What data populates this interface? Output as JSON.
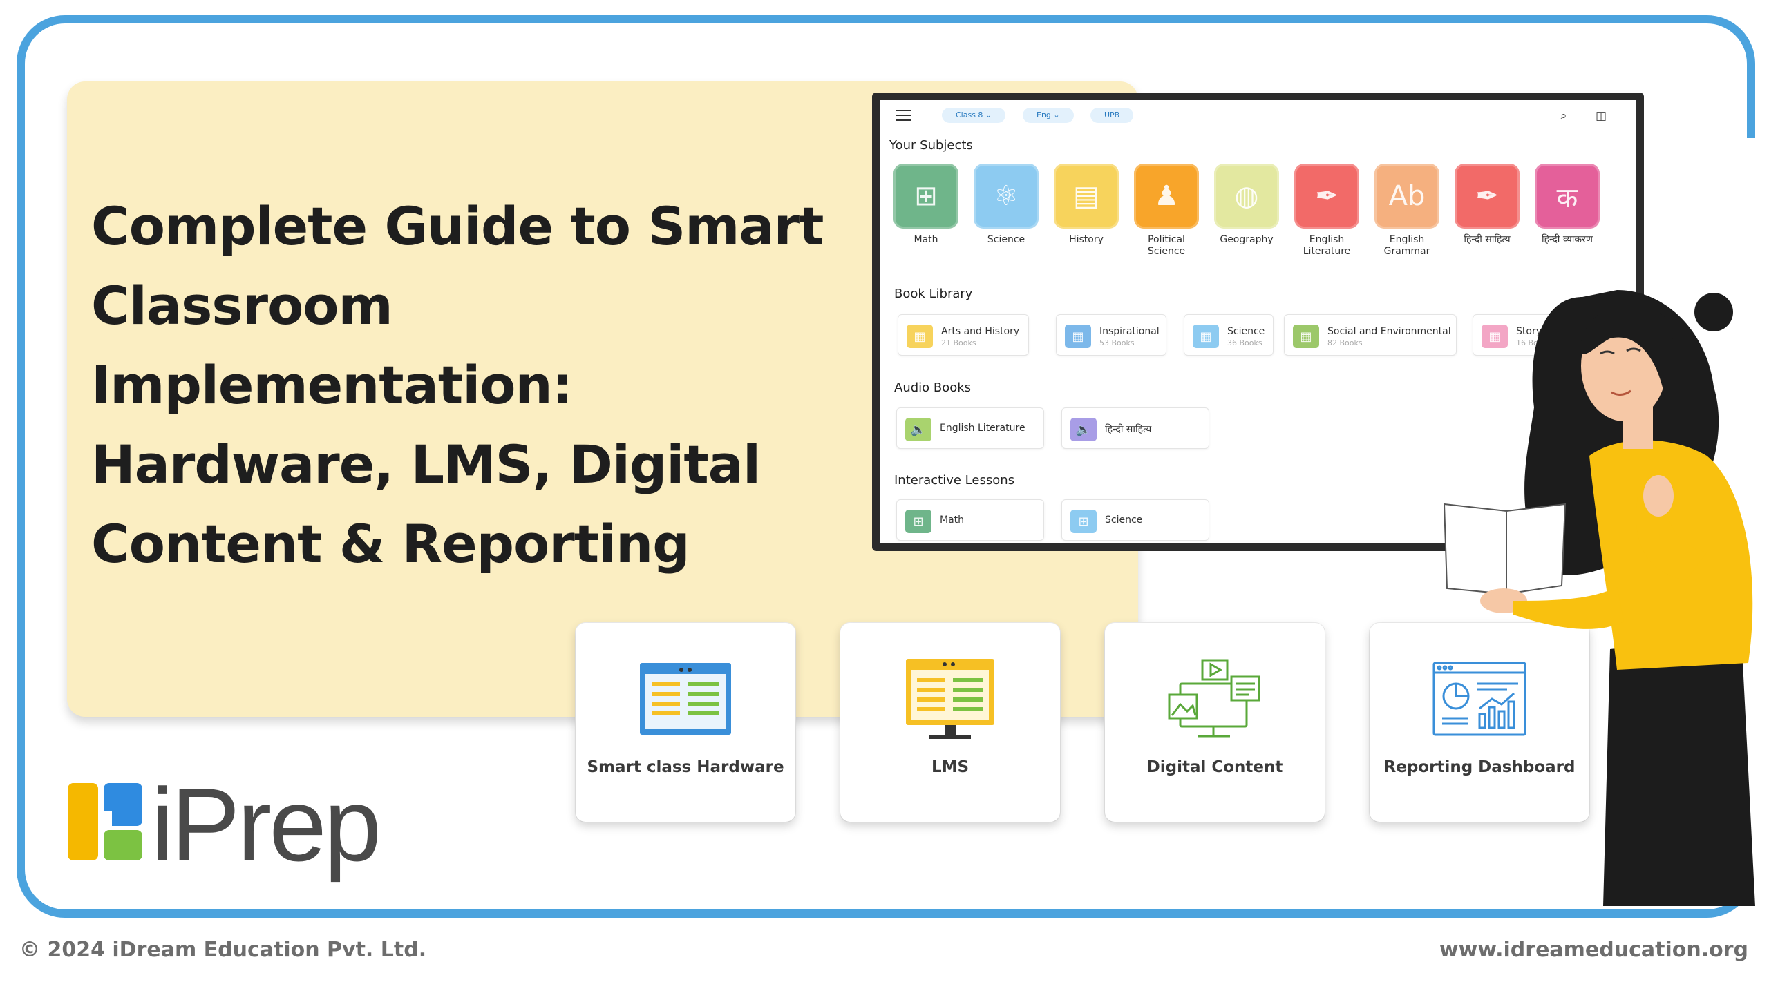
{
  "headline": {
    "line1": "Complete Guide to Smart",
    "line2": "Classroom Implementation:",
    "line3": "Hardware, LMS, Digital",
    "line4": "Content & Reporting"
  },
  "app": {
    "topbar": {
      "class_pill": "Class 8  ⌄",
      "lang_pill": "Eng  ⌄",
      "board_pill": "UPB",
      "search_icon": "search-icon",
      "bag_icon": "bag-icon"
    },
    "subjects_title": "Your Subjects",
    "subjects": [
      {
        "label": "Math",
        "color": "#6fb58a",
        "glyph": "⊞"
      },
      {
        "label": "Science",
        "color": "#8dcbf1",
        "glyph": "⚛"
      },
      {
        "label": "History",
        "color": "#f7d35c",
        "glyph": "▤"
      },
      {
        "label": "Political Science",
        "color": "#f8a52a",
        "glyph": "♟"
      },
      {
        "label": "Geography",
        "color": "#e3e8a0",
        "glyph": "◍"
      },
      {
        "label": "English Literature",
        "color": "#f26a68",
        "glyph": "✒"
      },
      {
        "label": "English Grammar",
        "color": "#f5b07f",
        "glyph": "Ab"
      },
      {
        "label": "हिन्दी साहित्य",
        "color": "#f26a68",
        "glyph": "✒"
      },
      {
        "label": "हिन्दी व्याकरण",
        "color": "#e4609a",
        "glyph": "क"
      }
    ],
    "library_title": "Book Library",
    "library": [
      {
        "title": "Arts and History",
        "count": "21 Books",
        "color": "#f7d35c"
      },
      {
        "title": "Inspirational",
        "count": "53 Books",
        "color": "#7cb8ea"
      },
      {
        "title": "Science",
        "count": "36 Books",
        "color": "#8dcbf1"
      },
      {
        "title": "Social and Environmental",
        "count": "82 Books",
        "color": "#9cc86a"
      },
      {
        "title": "Story Books",
        "count": "16 Books",
        "color": "#f3a6c5"
      }
    ],
    "audio_title": "Audio Books",
    "audio": [
      {
        "title": "English Literature",
        "color": "#a9d36e"
      },
      {
        "title": "हिन्दी साहित्य",
        "color": "#a89de6"
      }
    ],
    "lessons_title": "Interactive Lessons",
    "lessons": [
      {
        "title": "Math",
        "color": "#6fb58a"
      },
      {
        "title": "Science",
        "color": "#8dcbf1"
      }
    ]
  },
  "features": [
    {
      "label": "Smart class Hardware",
      "icon": "smart-board-icon"
    },
    {
      "label": "LMS",
      "icon": "monitor-icon"
    },
    {
      "label": "Digital Content",
      "icon": "digital-content-icon"
    },
    {
      "label": "Reporting Dashboard",
      "icon": "dashboard-icon"
    }
  ],
  "logo": {
    "text": "iPrep"
  },
  "footer": {
    "copyright": "© 2024 iDream Education Pvt. Ltd.",
    "website": "www.idreameducation.org"
  },
  "colors": {
    "frame": "#4ba3de",
    "panel": "#fbeec2",
    "logo_yellow": "#f5b800",
    "logo_blue": "#2f8be0",
    "logo_green": "#7cc242"
  }
}
